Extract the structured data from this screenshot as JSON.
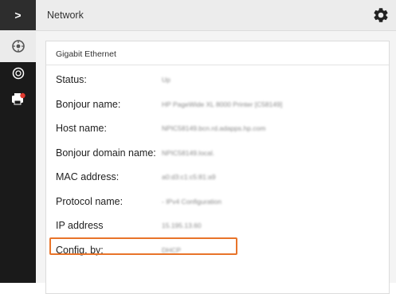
{
  "sidebar": {
    "items": [
      {
        "icon": "chevron-right-icon",
        "glyph": ">",
        "selected": false
      },
      {
        "icon": "network-icon",
        "selected": true
      },
      {
        "icon": "globe-icon",
        "selected": false
      },
      {
        "icon": "printer-alert-icon",
        "selected": false
      }
    ]
  },
  "header": {
    "title": "Network",
    "settings_icon": "gear-icon"
  },
  "card": {
    "title": "Gigabit Ethernet",
    "rows": [
      {
        "label": "Status:",
        "value": "Up"
      },
      {
        "label": "Bonjour name:",
        "value": "HP PageWide XL 8000 Printer [C58149]"
      },
      {
        "label": "Host name:",
        "value": "NPIC58149.bcn.rd.adapps.hp.com"
      },
      {
        "label": "Bonjour domain name:",
        "value": "NPIC58149.local."
      },
      {
        "label": "MAC address:",
        "value": "a0:d3:c1:c5:81:a9"
      },
      {
        "label": "Protocol name:",
        "value": "- IPv4 Configuration"
      },
      {
        "label": "IP address",
        "value": "15.195.13.60"
      },
      {
        "label": "Config. by:",
        "value": "DHCP"
      }
    ]
  },
  "colors": {
    "sidebar_bg": "#1a1a1a",
    "highlight": "#e8742a",
    "header_bg": "#ececec"
  }
}
